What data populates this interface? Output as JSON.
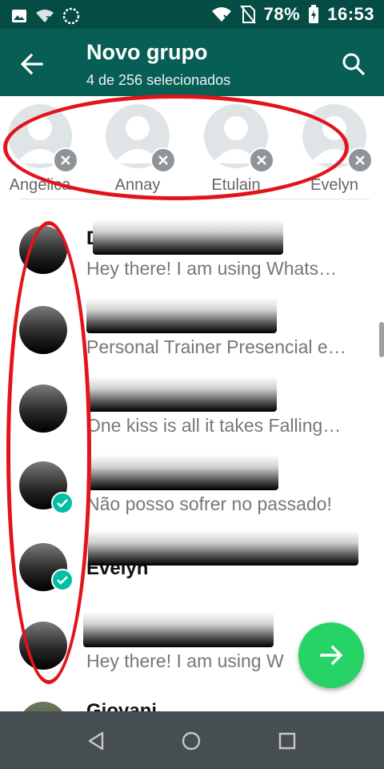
{
  "status_bar": {
    "battery": "78%",
    "time": "16:53",
    "icons": [
      "image-icon",
      "wifi-question-icon",
      "sync-icon",
      "wifi-icon",
      "no-sim-icon",
      "battery-charging-icon"
    ]
  },
  "app_bar": {
    "title": "Novo grupo",
    "subtitle": "4 de 256 selecionados",
    "back_icon": "arrow-back-icon",
    "search_icon": "search-icon"
  },
  "selected": [
    {
      "name": "Angelica"
    },
    {
      "name": "Annay"
    },
    {
      "name": "Etulain"
    },
    {
      "name": "Evelyn"
    }
  ],
  "contacts": [
    {
      "name": "D",
      "status": "Hey there! I am using Whats…",
      "selected": false
    },
    {
      "name": "",
      "status": "Personal Trainer Presencial e…",
      "selected": false
    },
    {
      "name": "",
      "status": "One kiss is all it takes Falling…",
      "selected": false
    },
    {
      "name": "",
      "status": "Não posso sofrer no passado!",
      "selected": true
    },
    {
      "name": "Evelyn",
      "status": "",
      "selected": true
    },
    {
      "name": "",
      "status": "Hey there! I am using W",
      "selected": false
    },
    {
      "name": "Giovani",
      "status": "",
      "selected": false
    }
  ],
  "fab": {
    "icon": "arrow-forward-icon"
  },
  "colors": {
    "app_bar": "#075e54",
    "status_bar": "#054d44",
    "fab": "#25d366",
    "check": "#00bfa5",
    "annotation": "#e3131b"
  },
  "nav_bar": [
    "back-triangle-icon",
    "home-circle-icon",
    "recents-square-icon"
  ]
}
